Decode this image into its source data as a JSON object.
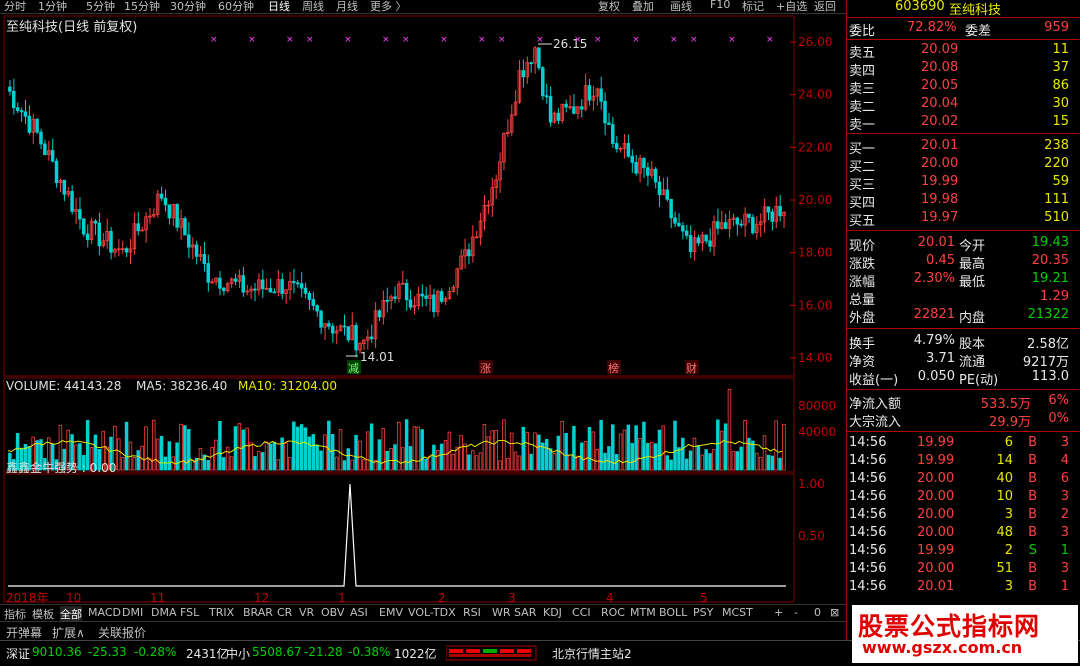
{
  "toolbar": {
    "periods": [
      "分时",
      "1分钟",
      "5分钟",
      "15分钟",
      "30分钟",
      "60分钟",
      "日线",
      "周线",
      "月线",
      "更多 〉"
    ],
    "right_buttons": [
      "复权",
      "叠加",
      "画线",
      "F10",
      "标记",
      "+自选",
      "返回"
    ]
  },
  "chart": {
    "title": "至纯科技(日线 前复权)",
    "high_label": "26.15",
    "low_label": "14.01",
    "price_axis": [
      "26.00",
      "24.00",
      "22.00",
      "20.00",
      "18.00",
      "16.00",
      "14.00"
    ],
    "date_axis": [
      "2018年",
      "10",
      "11",
      "12",
      "1",
      "2",
      "3",
      "4",
      "5"
    ],
    "event_markers": [
      "减",
      "涨",
      "榜",
      "财"
    ],
    "volume_legend": {
      "label": "VOLUME: 44143.28",
      "ma5": "MA5: 38236.40",
      "ma10": "MA10: 31204.00"
    },
    "volume_axis": [
      "80000",
      "40000"
    ],
    "indicator_legend": "鑫鑫金牛强势 : 0.00",
    "indicator_axis": [
      "1.00",
      "0.50"
    ],
    "colors": {
      "up": "#ff4040",
      "down": "#00d0d0",
      "ma": "#e8e800",
      "ma2": "#ff40ff"
    }
  },
  "quote": {
    "code": "603690",
    "name": "至纯科技",
    "weibi_label": "委比",
    "weibi": "72.82%",
    "weicha_label": "委差",
    "weicha": "959",
    "asks": [
      {
        "label": "卖五",
        "price": "20.09",
        "vol": "11"
      },
      {
        "label": "卖四",
        "price": "20.08",
        "vol": "37"
      },
      {
        "label": "卖三",
        "price": "20.05",
        "vol": "86"
      },
      {
        "label": "卖二",
        "price": "20.04",
        "vol": "30"
      },
      {
        "label": "卖一",
        "price": "20.02",
        "vol": "15"
      }
    ],
    "bids": [
      {
        "label": "买一",
        "price": "20.01",
        "vol": "238"
      },
      {
        "label": "买二",
        "price": "20.00",
        "vol": "220"
      },
      {
        "label": "买三",
        "price": "19.99",
        "vol": "59"
      },
      {
        "label": "买四",
        "price": "19.98",
        "vol": "111"
      },
      {
        "label": "买五",
        "price": "19.97",
        "vol": "510"
      }
    ],
    "stats": [
      {
        "l1": "现价",
        "v1": "20.01",
        "l2": "今开",
        "v2": "19.43",
        "c1": "red",
        "c2": "green"
      },
      {
        "l1": "涨跌",
        "v1": "0.45",
        "l2": "最高",
        "v2": "20.35",
        "c1": "red",
        "c2": "red"
      },
      {
        "l1": "涨幅",
        "v1": "2.30%",
        "l2": "最低",
        "v2": "19.21",
        "c1": "red",
        "c2": "green"
      },
      {
        "l1": "总量",
        "v1": "",
        "l2": "",
        "v2": "1.29",
        "c1": "white",
        "c2": "red"
      },
      {
        "l1": "外盘",
        "v1": "22821",
        "l2": "内盘",
        "v2": "21322",
        "c1": "red",
        "c2": "green"
      }
    ],
    "stats2": [
      {
        "l1": "换手",
        "v1": "4.79%",
        "l2": "股本",
        "v2": "2.58亿"
      },
      {
        "l1": "净资",
        "v1": "3.71",
        "l2": "流通",
        "v2": "9217万"
      },
      {
        "l1": "收益(一)",
        "v1": "0.050",
        "l2": "PE(动)",
        "v2": "113.0"
      }
    ],
    "flows": [
      {
        "label": "净流入额",
        "val": "533.5万",
        "pct": "6%"
      },
      {
        "label": "大宗流入",
        "val": "29.9万",
        "pct": "0%"
      }
    ],
    "ticks": [
      {
        "time": "14:56",
        "price": "19.99",
        "vol": "6",
        "bs": "B",
        "n": "3",
        "pc": "red",
        "bc": "red"
      },
      {
        "time": "14:56",
        "price": "19.99",
        "vol": "14",
        "bs": "B",
        "n": "4",
        "pc": "red",
        "bc": "red"
      },
      {
        "time": "14:56",
        "price": "20.00",
        "vol": "40",
        "bs": "B",
        "n": "6",
        "pc": "red",
        "bc": "red"
      },
      {
        "time": "14:56",
        "price": "20.00",
        "vol": "10",
        "bs": "B",
        "n": "3",
        "pc": "red",
        "bc": "red"
      },
      {
        "time": "14:56",
        "price": "20.00",
        "vol": "3",
        "bs": "B",
        "n": "2",
        "pc": "red",
        "bc": "red"
      },
      {
        "time": "14:56",
        "price": "20.00",
        "vol": "48",
        "bs": "B",
        "n": "3",
        "pc": "red",
        "bc": "red"
      },
      {
        "time": "14:56",
        "price": "19.99",
        "vol": "2",
        "bs": "S",
        "n": "1",
        "pc": "red",
        "bc": "green"
      },
      {
        "time": "14:56",
        "price": "20.00",
        "vol": "51",
        "bs": "B",
        "n": "3",
        "pc": "red",
        "bc": "red"
      },
      {
        "time": "14:56",
        "price": "20.01",
        "vol": "3",
        "bs": "B",
        "n": "1",
        "pc": "red",
        "bc": "red"
      }
    ]
  },
  "tabs": {
    "row1": [
      "指标",
      "模板",
      "全部",
      "MACD",
      "DMI",
      "DMA",
      "FSL",
      "TRIX",
      "BRAR",
      "CR",
      "VR",
      "OBV",
      "ASI",
      "EMV",
      "VOL-TDX",
      "RSI",
      "WR",
      "SAR",
      "KDJ",
      "CCI",
      "ROC",
      "MTM",
      "BOLL",
      "PSY",
      "MCST"
    ],
    "row1_right": [
      "+",
      "-",
      "0",
      "⊠"
    ],
    "row2": [
      "开弹幕",
      "扩展∧",
      "关联报价"
    ]
  },
  "status": {
    "sz_label": "深证",
    "sz_val": "9010.36",
    "sz_chg": "-25.33",
    "sz_pct": "-0.28%",
    "sz_amt": "2431亿",
    "zx_label": "中小",
    "zx_val": "5508.67",
    "zx_chg": "-21.28",
    "zx_pct": "-0.38%",
    "zx_amt": "1022亿",
    "site": "北京行情主站2"
  },
  "watermark": {
    "line1": "股票公式指标网",
    "line2": "www.gszx.com.cn"
  }
}
